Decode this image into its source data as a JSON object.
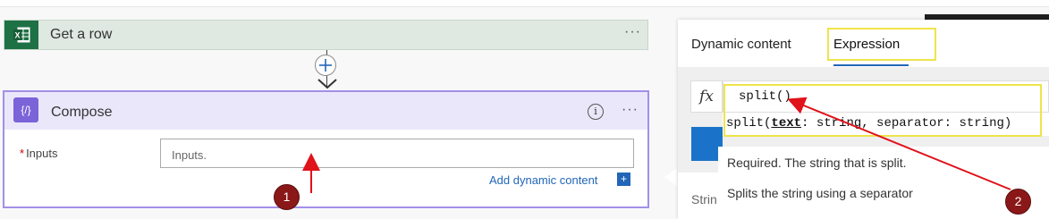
{
  "get_a_row": {
    "title": "Get a row",
    "more": "···"
  },
  "compose": {
    "title": "Compose",
    "icon": "{/}",
    "info": "i",
    "more": "···",
    "inputs_required_mark": "*",
    "inputs_label": "Inputs",
    "inputs_placeholder": "Inputs.",
    "add_dynamic_content": "Add dynamic content",
    "add_icon": "+"
  },
  "panel": {
    "tab_dynamic": "Dynamic content",
    "tab_expression": "Expression",
    "fx": "fx",
    "expression_value": "split()",
    "signature_prefix": "split(",
    "signature_param": "text",
    "signature_rest": ": string, separator: string)",
    "tooltip_required": "Required. The string that is split.",
    "tooltip_desc": "Splits the string using a separator",
    "partial_label": "Strin"
  },
  "badges": {
    "one": "1",
    "two": "2"
  },
  "colors": {
    "highlight_yellow": "#eee44a",
    "arrow_red": "#e0121a",
    "compose_accent": "#7b63d8",
    "excel_green": "#1e7145",
    "link_blue": "#2266b8"
  },
  "icons": [
    "excel-icon",
    "plus-icon",
    "arrow-down-icon",
    "compose-icon",
    "info-icon",
    "more-icon",
    "fx-icon",
    "search-icon"
  ]
}
